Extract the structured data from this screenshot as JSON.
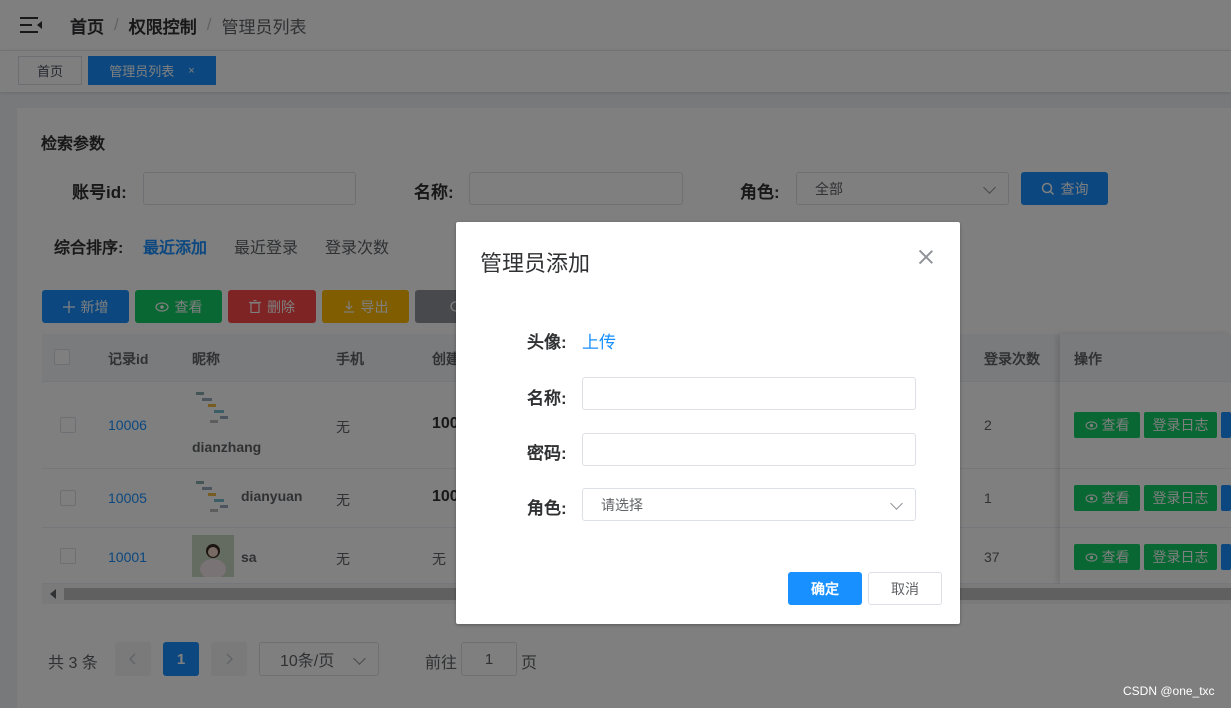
{
  "header": {
    "breadcrumb": [
      "首页",
      "权限控制",
      "管理员列表"
    ],
    "separator": "/"
  },
  "tags": [
    {
      "label": "首页"
    },
    {
      "label": "管理员列表",
      "close": "×"
    }
  ],
  "search": {
    "title": "检索参数",
    "account_label": "账号id:",
    "account_value": "",
    "name_label": "名称:",
    "name_value": "",
    "role_label": "角色:",
    "role_value": "全部",
    "query_button": "查询"
  },
  "sort": {
    "label": "综合排序:",
    "options": [
      "最近添加",
      "最近登录",
      "登录次数"
    ],
    "active": "最近添加"
  },
  "actions": [
    {
      "label": "新增",
      "icon": "plus-icon",
      "color": "#1890ff"
    },
    {
      "label": "查看",
      "icon": "eye-icon",
      "color": "#13ce66"
    },
    {
      "label": "删除",
      "icon": "trash-icon",
      "color": "#ff4949"
    },
    {
      "label": "导出",
      "icon": "download-icon",
      "color": "#ffba00"
    },
    {
      "label": "",
      "icon": "refresh-icon",
      "color": "#909399"
    }
  ],
  "table": {
    "columns": [
      "记录id",
      "昵称",
      "手机",
      "创建",
      "登录次数",
      "操作"
    ],
    "rows": [
      {
        "id": "10006",
        "nickname": "dianzhang",
        "phone": "无",
        "created": "100",
        "logins": "2"
      },
      {
        "id": "10005",
        "nickname": "dianyuan",
        "phone": "无",
        "created": "100",
        "logins": "1"
      },
      {
        "id": "10001",
        "nickname": "sa",
        "phone": "无",
        "created": "无",
        "logins": "37"
      }
    ],
    "op_view": "查看",
    "op_log": "登录日志"
  },
  "pagination": {
    "total": "共 3 条",
    "current": "1",
    "page_size": "10条/页",
    "goto_label": "前往",
    "goto_value": "1",
    "page_unit": "页"
  },
  "dialog": {
    "title": "管理员添加",
    "avatar_label": "头像:",
    "upload_link": "上传",
    "name_label": "名称:",
    "name_value": "",
    "password_label": "密码:",
    "password_value": "",
    "role_label": "角色:",
    "role_placeholder": "请选择",
    "confirm": "确定",
    "cancel": "取消"
  },
  "watermark": "CSDN @one_txc",
  "colors": {
    "primary": "#1890ff",
    "success": "#13ce66",
    "danger": "#ff4949",
    "warning": "#ffba00",
    "info": "#909399"
  }
}
